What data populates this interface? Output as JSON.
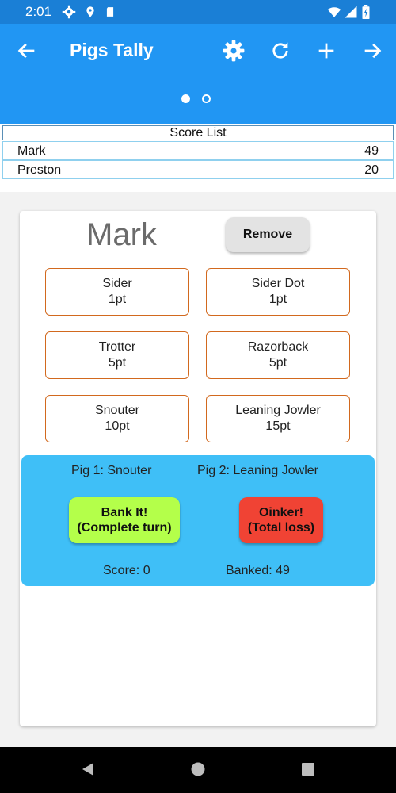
{
  "status_bar": {
    "time": "2:01",
    "icons": [
      "gear-icon",
      "location-icon",
      "sd-card-icon",
      "wifi-icon",
      "signal-icon",
      "battery-icon"
    ]
  },
  "app_bar": {
    "title": "Pigs Tally",
    "icons": [
      "back-arrow-icon",
      "settings-icon",
      "refresh-icon",
      "add-icon",
      "forward-arrow-icon"
    ],
    "page_count": 2,
    "active_page": 1,
    "color": "#2196f3"
  },
  "score_list": {
    "header": "Score List",
    "rows": [
      {
        "name": "Mark",
        "score": "49"
      },
      {
        "name": "Preston",
        "score": "20"
      }
    ]
  },
  "player": {
    "name": "Mark",
    "remove_label": "Remove"
  },
  "positions": [
    {
      "name": "Sider",
      "points": "1pt"
    },
    {
      "name": "Sider Dot",
      "points": "1pt"
    },
    {
      "name": "Trotter",
      "points": "5pt"
    },
    {
      "name": "Razorback",
      "points": "5pt"
    },
    {
      "name": "Snouter",
      "points": "10pt"
    },
    {
      "name": "Leaning Jowler",
      "points": "15pt"
    }
  ],
  "turn": {
    "pig1": "Pig 1: Snouter",
    "pig2": "Pig 2: Leaning Jowler",
    "bank_line1": "Bank It!",
    "bank_line2": "(Complete turn)",
    "oink_line1": "Oinker!",
    "oink_line2": "(Total loss)",
    "score": "Score: 0",
    "banked": "Banked: 49",
    "panel_color": "#3fbff7",
    "bank_color": "#b4ff4a",
    "oink_color": "#f04334"
  },
  "nav_bar": {
    "icons": [
      "back-triangle-icon",
      "home-circle-icon",
      "recents-square-icon"
    ]
  }
}
